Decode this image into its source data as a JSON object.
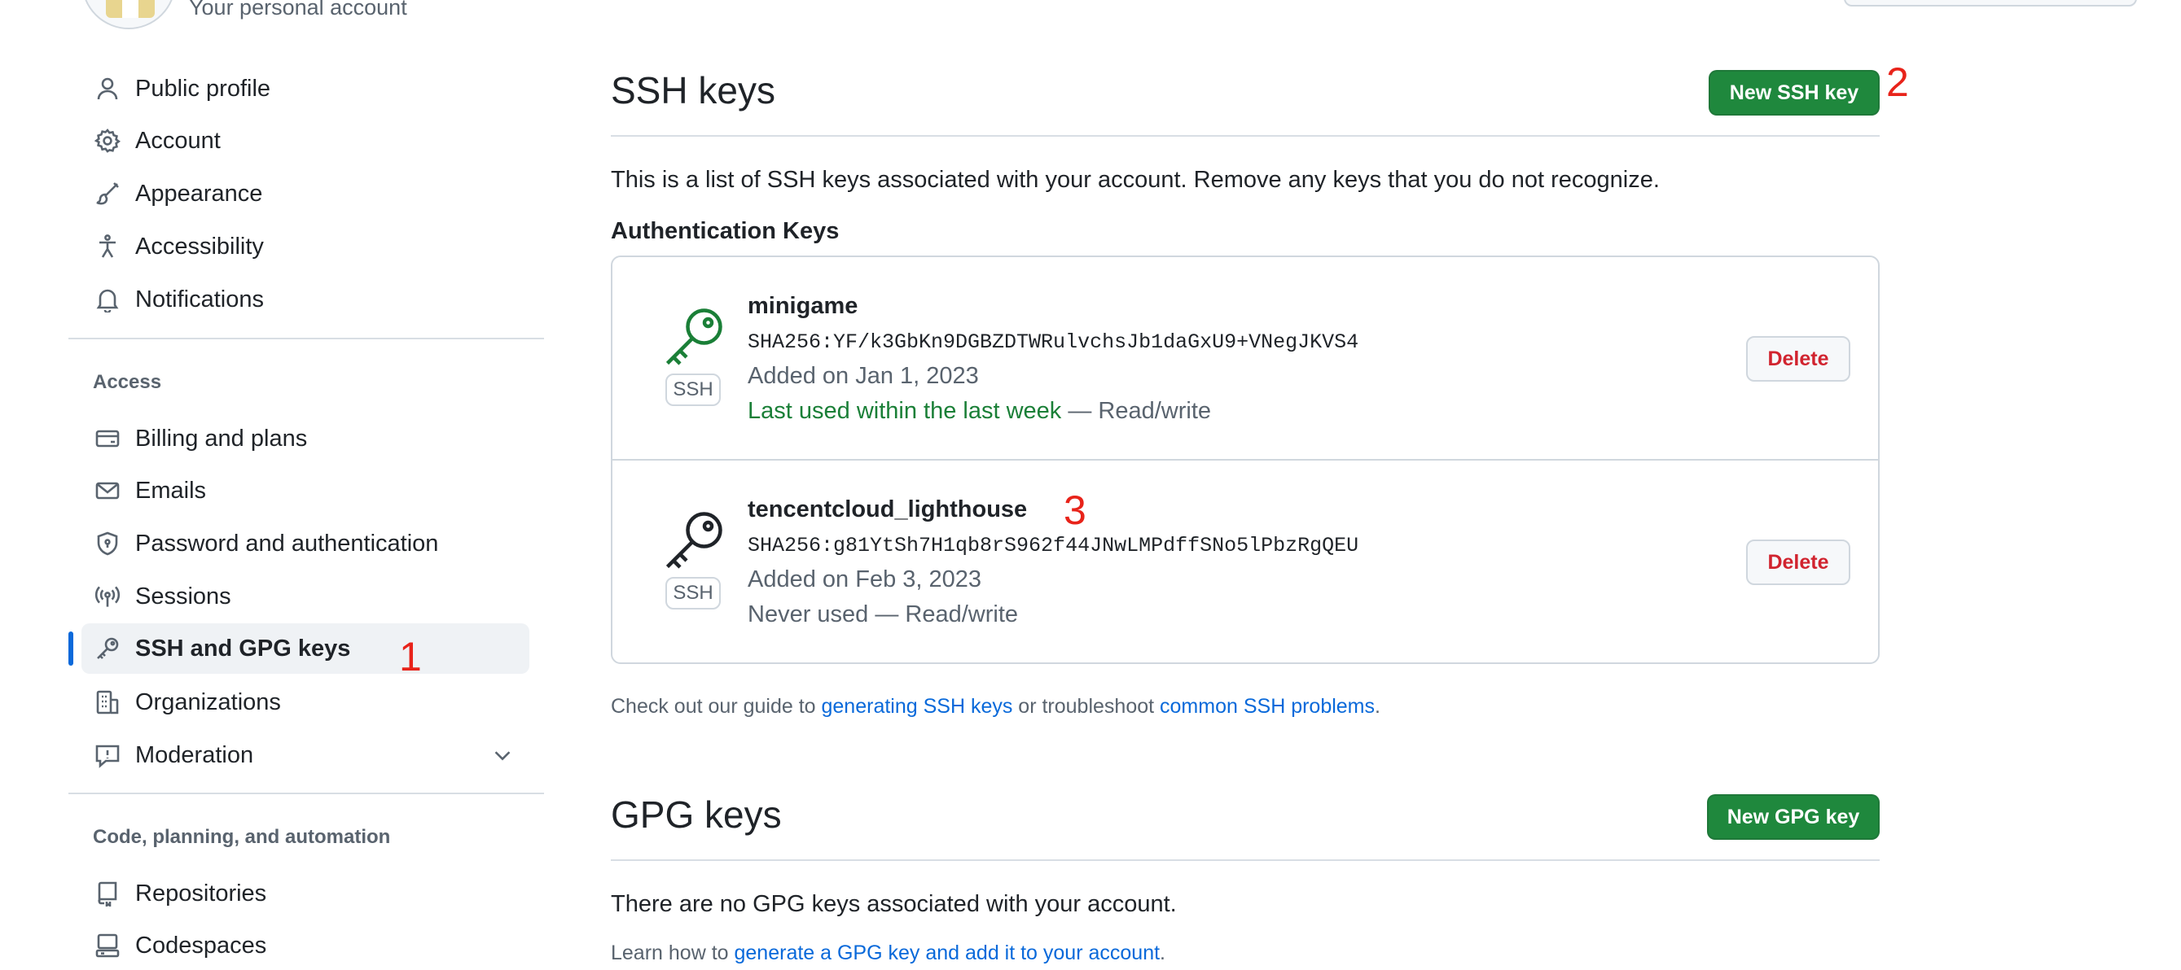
{
  "header": {
    "subtitle": "Your personal account"
  },
  "sidebar": {
    "items_top": [
      {
        "label": "Public profile",
        "icon": "person-icon"
      },
      {
        "label": "Account",
        "icon": "gear-icon"
      },
      {
        "label": "Appearance",
        "icon": "paintbrush-icon"
      },
      {
        "label": "Accessibility",
        "icon": "accessibility-icon"
      },
      {
        "label": "Notifications",
        "icon": "bell-icon"
      }
    ],
    "access_heading": "Access",
    "items_access": [
      {
        "label": "Billing and plans",
        "icon": "credit-card-icon"
      },
      {
        "label": "Emails",
        "icon": "mail-icon"
      },
      {
        "label": "Password and authentication",
        "icon": "shield-lock-icon"
      },
      {
        "label": "Sessions",
        "icon": "broadcast-icon"
      },
      {
        "label": "SSH and GPG keys",
        "icon": "key-icon",
        "active": true
      },
      {
        "label": "Organizations",
        "icon": "organization-icon"
      },
      {
        "label": "Moderation",
        "icon": "report-icon"
      }
    ],
    "code_heading": "Code, planning, and automation",
    "items_code": [
      {
        "label": "Repositories",
        "icon": "repo-icon"
      },
      {
        "label": "Codespaces",
        "icon": "codespaces-icon"
      }
    ]
  },
  "ssh": {
    "title": "SSH keys",
    "new_button": "New SSH key",
    "description": "This is a list of SSH keys associated with your account. Remove any keys that you do not recognize.",
    "auth_heading": "Authentication Keys",
    "keys": [
      {
        "name": "minigame",
        "fingerprint": "SHA256:YF/k3GbKn9DGBZDTWRulvchsJb1daGxU9+VNegJKVS4",
        "added": "Added on Jan 1, 2023",
        "last_used": "Last used within the last week",
        "access": " — Read/write",
        "badge": "SSH",
        "delete_label": "Delete",
        "icon_color": "#1a7f37"
      },
      {
        "name": "tencentcloud_lighthouse",
        "fingerprint": "SHA256:g81YtSh7H1qb8rS962f44JNwLMPdffSNo5lPbzRgQEU",
        "added": "Added on Feb 3, 2023",
        "last_used": "Never used — Read/write",
        "badge": "SSH",
        "delete_label": "Delete",
        "icon_color": "#1f2328"
      }
    ],
    "guide_prefix": "Check out our guide to ",
    "guide_link1": "generating SSH keys",
    "guide_middle": " or troubleshoot ",
    "guide_link2": "common SSH problems",
    "guide_suffix": "."
  },
  "gpg": {
    "title": "GPG keys",
    "new_button": "New GPG key",
    "empty_text": "There are no GPG keys associated with your account.",
    "learn_prefix": "Learn how to ",
    "learn_link": "generate a GPG key and add it to your account",
    "learn_suffix": "."
  },
  "annotations": {
    "m1": "1",
    "m2": "2",
    "m3": "3",
    "color": "#e8231a"
  },
  "colors": {
    "accent": "#0969da",
    "primary_button": "#1f883d",
    "danger": "#d1242f",
    "success": "#1a7f37"
  }
}
